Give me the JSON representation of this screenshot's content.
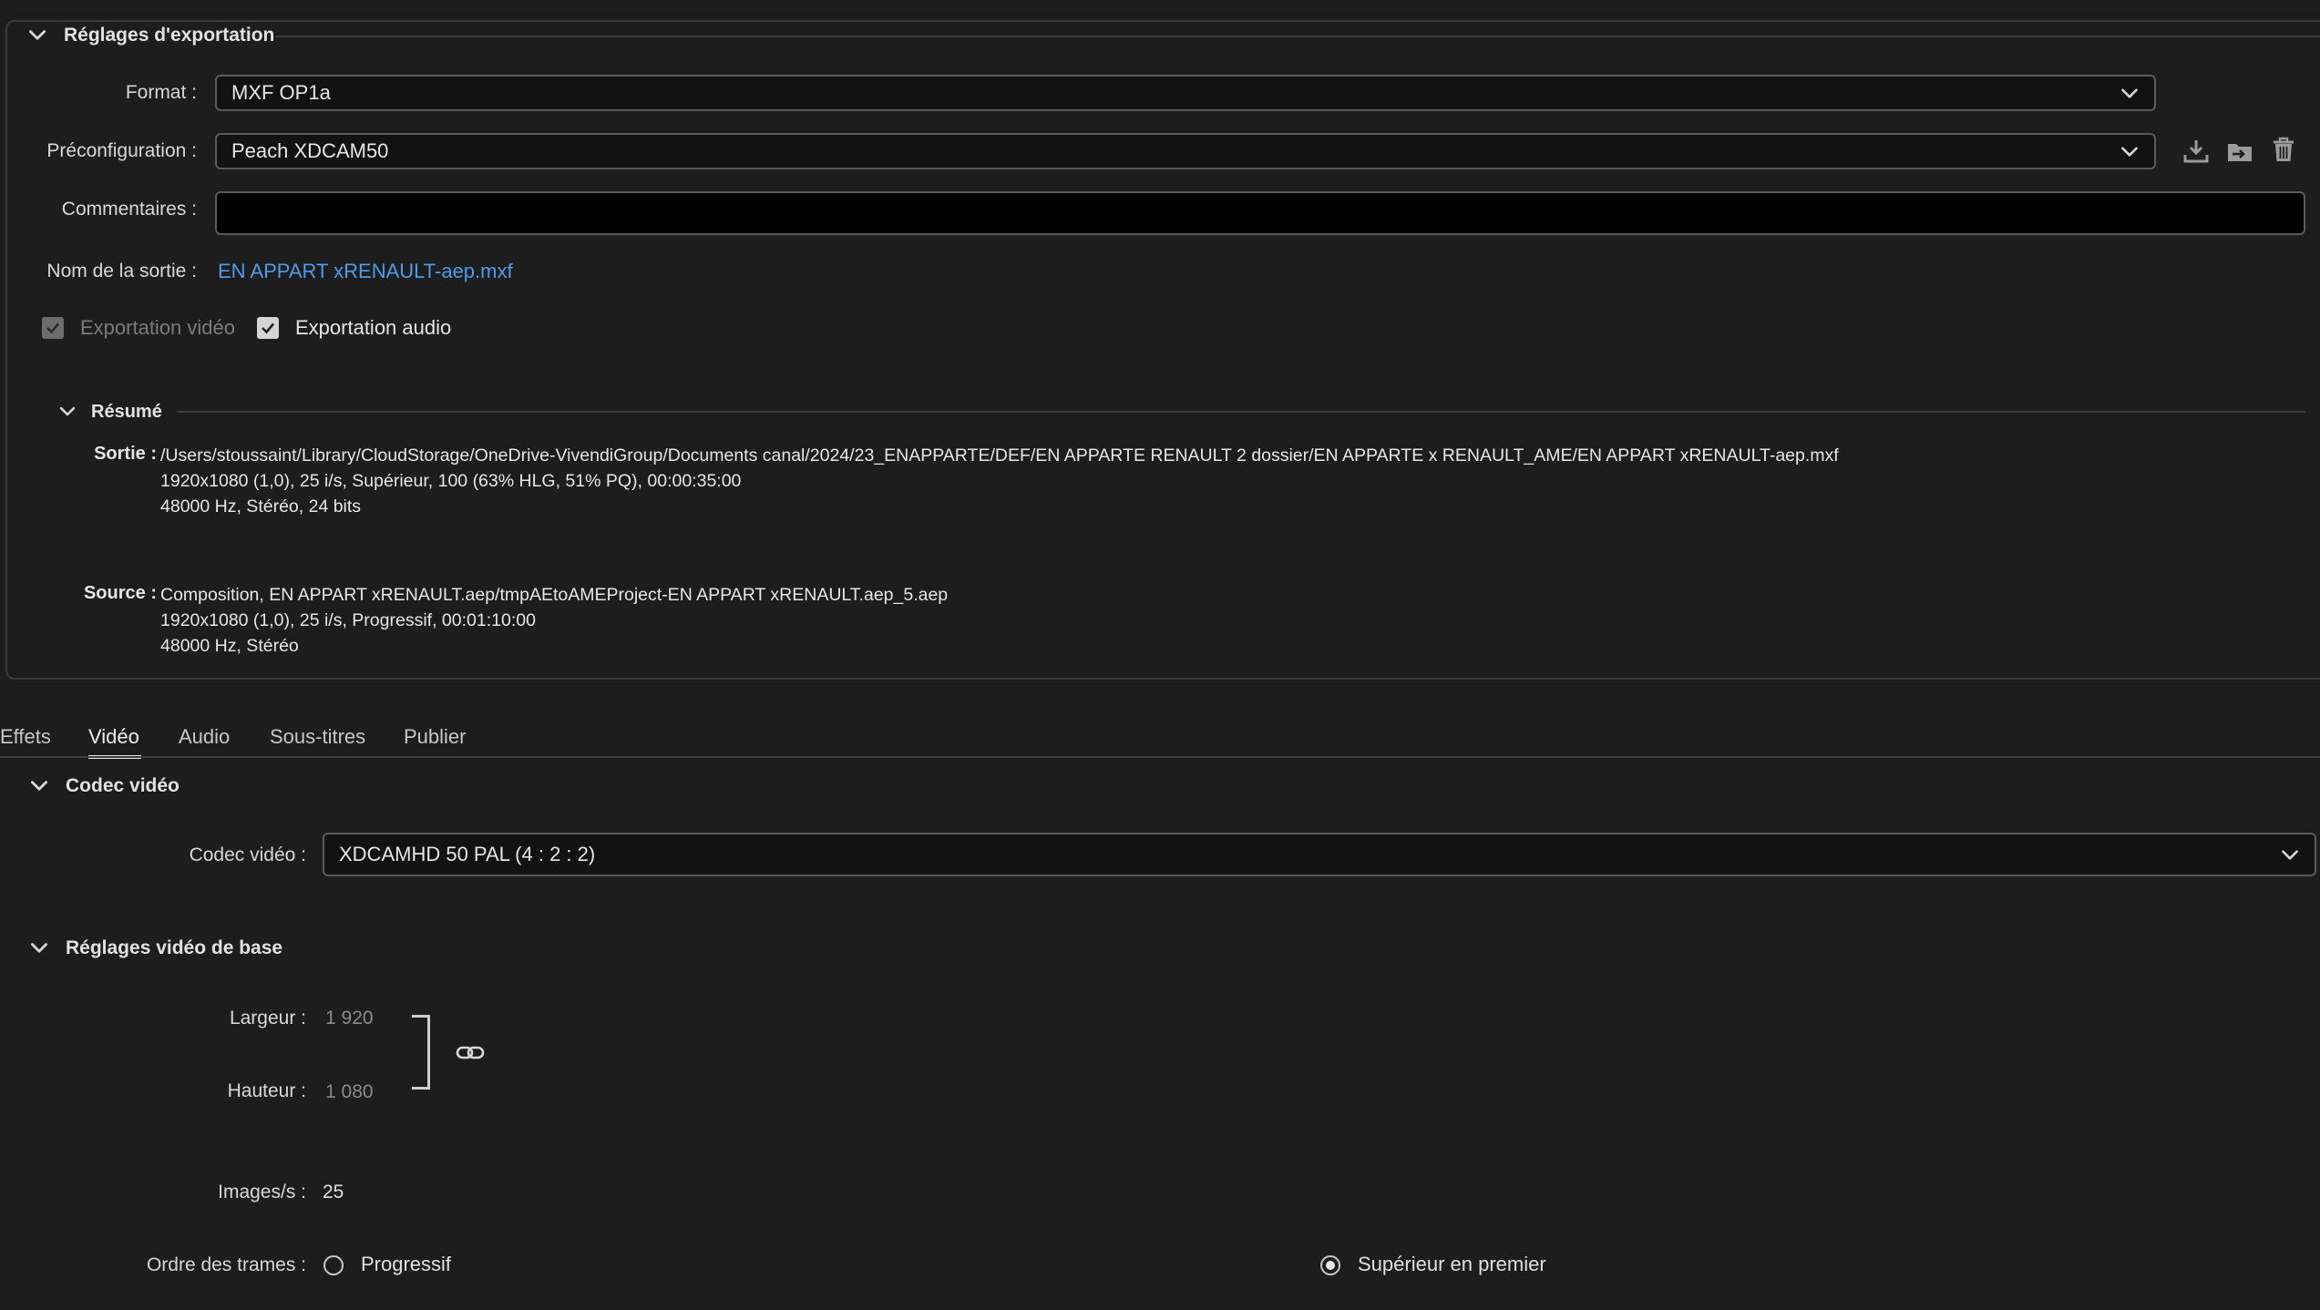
{
  "export_settings": {
    "title": "Réglages d'exportation",
    "format_label": "Format :",
    "format_value": "MXF OP1a",
    "preset_label": "Préconfiguration :",
    "preset_value": "Peach XDCAM50",
    "comments_label": "Commentaires :",
    "comments_value": "",
    "output_name_label": "Nom de la sortie :",
    "output_name_value": "EN APPART xRENAULT-aep.mxf",
    "export_video_label": "Exportation vidéo",
    "export_video_checked": true,
    "export_audio_label": "Exportation audio",
    "export_audio_checked": true
  },
  "summary": {
    "title": "Résumé",
    "output_label": "Sortie :",
    "output_lines": [
      "/Users/stoussaint/Library/CloudStorage/OneDrive-VivendiGroup/Documents canal/2024/23_ENAPPARTE/DEF/EN APPARTE RENAULT 2 dossier/EN APPARTE x RENAULT_AME/EN APPART xRENAULT-aep.mxf",
      "1920x1080 (1,0), 25 i/s, Supérieur, 100 (63% HLG, 51% PQ), 00:00:35:00",
      "48000  Hz, Stéréo, 24 bits"
    ],
    "source_label": "Source :",
    "source_lines": [
      "Composition, EN APPART xRENAULT.aep/tmpAEtoAMEProject-EN APPART xRENAULT.aep_5.aep",
      "1920x1080 (1,0), 25 i/s, Progressif, 00:01:10:00",
      "48000 Hz, Stéréo"
    ]
  },
  "tabs": [
    {
      "label": "Effets",
      "active": false
    },
    {
      "label": "Vidéo",
      "active": true
    },
    {
      "label": "Audio",
      "active": false
    },
    {
      "label": "Sous-titres",
      "active": false
    },
    {
      "label": "Publier",
      "active": false
    }
  ],
  "video_codec": {
    "section_title": "Codec vidéo",
    "codec_label": "Codec vidéo :",
    "codec_value": "XDCAMHD 50 PAL (4 : 2 : 2)"
  },
  "basic_video": {
    "section_title": "Réglages vidéo de base",
    "width_label": "Largeur :",
    "width_value": "1 920",
    "height_label": "Hauteur :",
    "height_value": "1 080",
    "fps_label": "Images/s :",
    "fps_value": "25",
    "field_order_label": "Ordre des trames :",
    "field_order_options": [
      {
        "label": "Progressif",
        "selected": false
      },
      {
        "label": "Supérieur en premier",
        "selected": true
      }
    ]
  },
  "icons": {
    "collapse": "chevron-down-icon",
    "dropdown": "chevron-down-icon",
    "save_preset": "download-icon",
    "import_preset": "import-folder-icon",
    "delete_preset": "trash-icon",
    "link_dimensions": "link-icon"
  },
  "colors": {
    "background": "#1d1d1d",
    "accent_link": "#4c9ce8",
    "active_tab_underline": "#e6e6e6"
  }
}
